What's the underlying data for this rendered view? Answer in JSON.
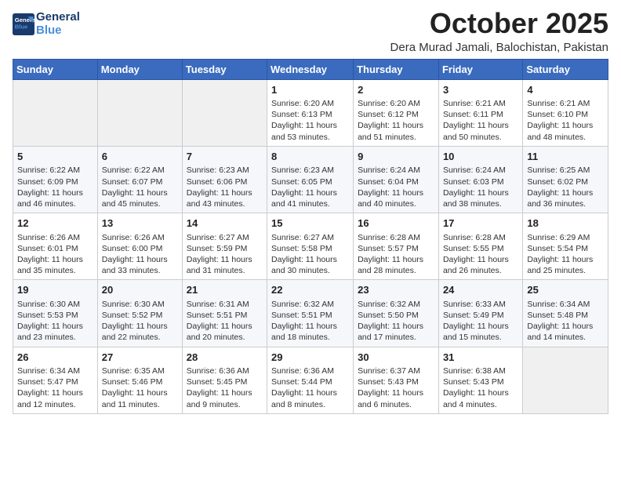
{
  "header": {
    "logo_line1": "General",
    "logo_line2": "Blue",
    "month": "October 2025",
    "location": "Dera Murad Jamali, Balochistan, Pakistan"
  },
  "weekdays": [
    "Sunday",
    "Monday",
    "Tuesday",
    "Wednesday",
    "Thursday",
    "Friday",
    "Saturday"
  ],
  "weeks": [
    [
      {
        "day": "",
        "empty": true
      },
      {
        "day": "",
        "empty": true
      },
      {
        "day": "",
        "empty": true
      },
      {
        "day": "1",
        "sunrise": "6:20 AM",
        "sunset": "6:13 PM",
        "daylight": "11 hours and 53 minutes."
      },
      {
        "day": "2",
        "sunrise": "6:20 AM",
        "sunset": "6:12 PM",
        "daylight": "11 hours and 51 minutes."
      },
      {
        "day": "3",
        "sunrise": "6:21 AM",
        "sunset": "6:11 PM",
        "daylight": "11 hours and 50 minutes."
      },
      {
        "day": "4",
        "sunrise": "6:21 AM",
        "sunset": "6:10 PM",
        "daylight": "11 hours and 48 minutes."
      }
    ],
    [
      {
        "day": "5",
        "sunrise": "6:22 AM",
        "sunset": "6:09 PM",
        "daylight": "11 hours and 46 minutes."
      },
      {
        "day": "6",
        "sunrise": "6:22 AM",
        "sunset": "6:07 PM",
        "daylight": "11 hours and 45 minutes."
      },
      {
        "day": "7",
        "sunrise": "6:23 AM",
        "sunset": "6:06 PM",
        "daylight": "11 hours and 43 minutes."
      },
      {
        "day": "8",
        "sunrise": "6:23 AM",
        "sunset": "6:05 PM",
        "daylight": "11 hours and 41 minutes."
      },
      {
        "day": "9",
        "sunrise": "6:24 AM",
        "sunset": "6:04 PM",
        "daylight": "11 hours and 40 minutes."
      },
      {
        "day": "10",
        "sunrise": "6:24 AM",
        "sunset": "6:03 PM",
        "daylight": "11 hours and 38 minutes."
      },
      {
        "day": "11",
        "sunrise": "6:25 AM",
        "sunset": "6:02 PM",
        "daylight": "11 hours and 36 minutes."
      }
    ],
    [
      {
        "day": "12",
        "sunrise": "6:26 AM",
        "sunset": "6:01 PM",
        "daylight": "11 hours and 35 minutes."
      },
      {
        "day": "13",
        "sunrise": "6:26 AM",
        "sunset": "6:00 PM",
        "daylight": "11 hours and 33 minutes."
      },
      {
        "day": "14",
        "sunrise": "6:27 AM",
        "sunset": "5:59 PM",
        "daylight": "11 hours and 31 minutes."
      },
      {
        "day": "15",
        "sunrise": "6:27 AM",
        "sunset": "5:58 PM",
        "daylight": "11 hours and 30 minutes."
      },
      {
        "day": "16",
        "sunrise": "6:28 AM",
        "sunset": "5:57 PM",
        "daylight": "11 hours and 28 minutes."
      },
      {
        "day": "17",
        "sunrise": "6:28 AM",
        "sunset": "5:55 PM",
        "daylight": "11 hours and 26 minutes."
      },
      {
        "day": "18",
        "sunrise": "6:29 AM",
        "sunset": "5:54 PM",
        "daylight": "11 hours and 25 minutes."
      }
    ],
    [
      {
        "day": "19",
        "sunrise": "6:30 AM",
        "sunset": "5:53 PM",
        "daylight": "11 hours and 23 minutes."
      },
      {
        "day": "20",
        "sunrise": "6:30 AM",
        "sunset": "5:52 PM",
        "daylight": "11 hours and 22 minutes."
      },
      {
        "day": "21",
        "sunrise": "6:31 AM",
        "sunset": "5:51 PM",
        "daylight": "11 hours and 20 minutes."
      },
      {
        "day": "22",
        "sunrise": "6:32 AM",
        "sunset": "5:51 PM",
        "daylight": "11 hours and 18 minutes."
      },
      {
        "day": "23",
        "sunrise": "6:32 AM",
        "sunset": "5:50 PM",
        "daylight": "11 hours and 17 minutes."
      },
      {
        "day": "24",
        "sunrise": "6:33 AM",
        "sunset": "5:49 PM",
        "daylight": "11 hours and 15 minutes."
      },
      {
        "day": "25",
        "sunrise": "6:34 AM",
        "sunset": "5:48 PM",
        "daylight": "11 hours and 14 minutes."
      }
    ],
    [
      {
        "day": "26",
        "sunrise": "6:34 AM",
        "sunset": "5:47 PM",
        "daylight": "11 hours and 12 minutes."
      },
      {
        "day": "27",
        "sunrise": "6:35 AM",
        "sunset": "5:46 PM",
        "daylight": "11 hours and 11 minutes."
      },
      {
        "day": "28",
        "sunrise": "6:36 AM",
        "sunset": "5:45 PM",
        "daylight": "11 hours and 9 minutes."
      },
      {
        "day": "29",
        "sunrise": "6:36 AM",
        "sunset": "5:44 PM",
        "daylight": "11 hours and 8 minutes."
      },
      {
        "day": "30",
        "sunrise": "6:37 AM",
        "sunset": "5:43 PM",
        "daylight": "11 hours and 6 minutes."
      },
      {
        "day": "31",
        "sunrise": "6:38 AM",
        "sunset": "5:43 PM",
        "daylight": "11 hours and 4 minutes."
      },
      {
        "day": "",
        "empty": true
      }
    ]
  ],
  "labels": {
    "sunrise": "Sunrise:",
    "sunset": "Sunset:",
    "daylight": "Daylight hours"
  }
}
